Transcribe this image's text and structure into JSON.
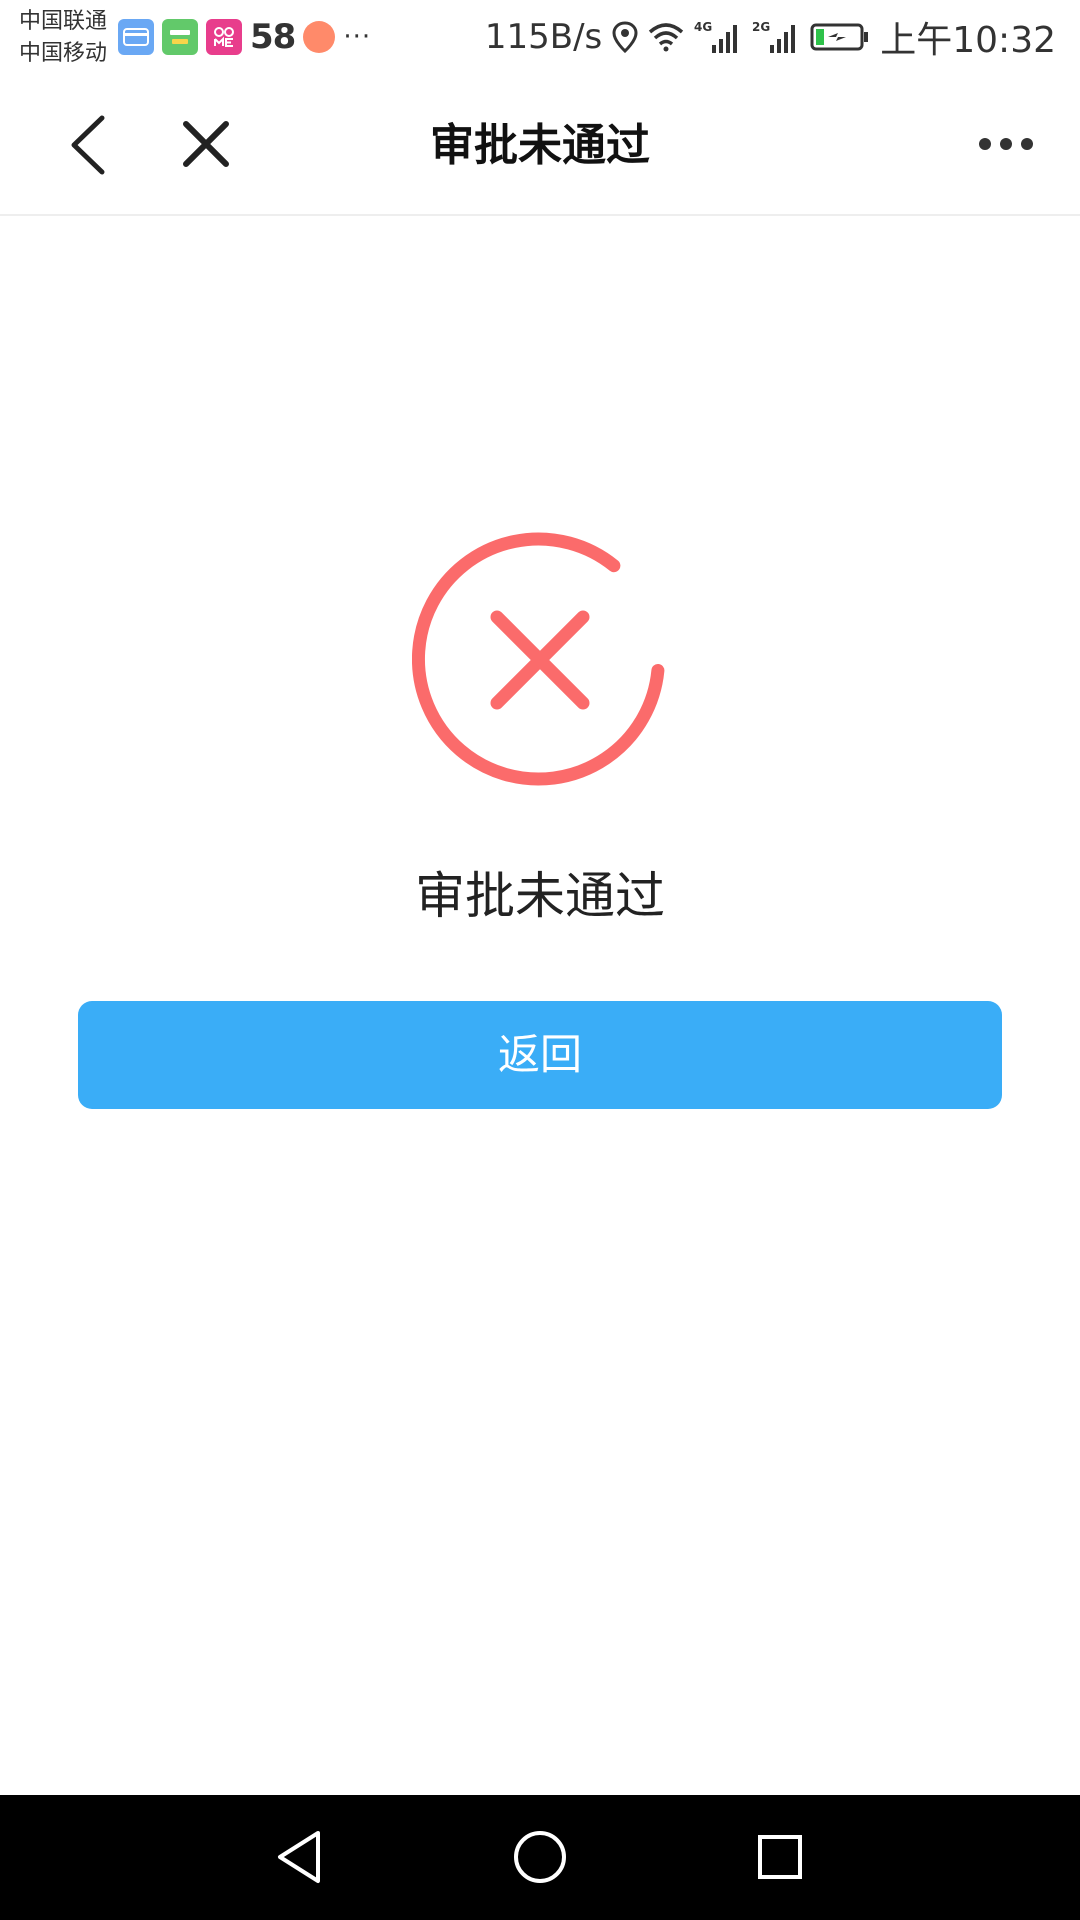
{
  "status_bar": {
    "carrier_1": "中国联通",
    "carrier_2": "中国移动",
    "notif_app_3": "58",
    "more": "···",
    "speed": "115B/s",
    "network_1": "4G",
    "network_2": "2G",
    "time": "上午10:32"
  },
  "nav": {
    "title": "审批未通过",
    "icons": [
      "chevron-left-icon",
      "close-icon",
      "more-horizontal-icon"
    ]
  },
  "result": {
    "status_text": "审批未通过",
    "icon": "error-circle-x-icon",
    "icon_color": "#fb6b6b"
  },
  "actions": {
    "return_label": "返回",
    "button_color": "#3aadf7"
  },
  "system_nav": {
    "icons": [
      "back-triangle-icon",
      "home-circle-icon",
      "recent-square-icon"
    ]
  }
}
